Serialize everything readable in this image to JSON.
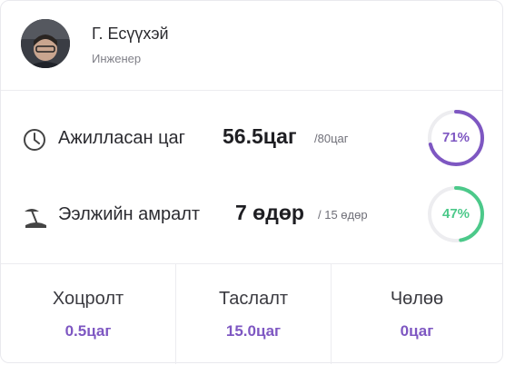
{
  "user": {
    "name": "Г. Есүүхэй",
    "role": "Инженер"
  },
  "stats": [
    {
      "icon": "clock-icon",
      "label": "Ажилласан цаг",
      "value": "56.5цаг",
      "total": "/80цаг",
      "percent_text": "71%",
      "percent": 71,
      "color": "#7e57c2"
    },
    {
      "icon": "beach-umbrella-icon",
      "label": "Ээлжийн амралт",
      "value": "7 өдөр",
      "total": "/ 15 өдөр",
      "percent_text": "47%",
      "percent": 47,
      "color": "#4cc98a"
    }
  ],
  "footer": [
    {
      "label": "Хоцролт",
      "value": "0.5цаг"
    },
    {
      "label": "Таслалт",
      "value": "15.0цаг"
    },
    {
      "label": "Чөлөө",
      "value": "0цаг"
    }
  ],
  "colors": {
    "accent": "#7e57c2",
    "success": "#4cc98a",
    "ring_track": "#ededf0"
  }
}
